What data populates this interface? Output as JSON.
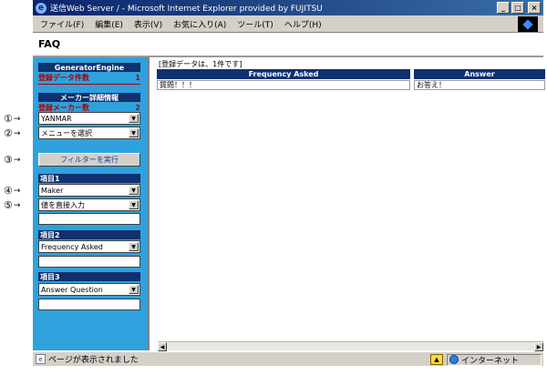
{
  "window": {
    "title": "送信Web Server / - Microsoft Internet Explorer provided by FUJITSU",
    "buttons": [
      "_",
      "□",
      "×"
    ]
  },
  "menu": [
    "ファイル(F)",
    "編集(E)",
    "表示(V)",
    "お気に入り(A)",
    "ツール(T)",
    "ヘルプ(H)"
  ],
  "page": {
    "title": "FAQ"
  },
  "sidebar": {
    "engine_header": "GeneratorEngine",
    "registered_data": {
      "label": "登録データ件数",
      "value": "1"
    },
    "maker_header": "メーカー詳細情報",
    "registered_makers": {
      "label": "登録メーカー数",
      "value": "2"
    },
    "maker_select": "YANMAR",
    "menu_select": "メニューを選択",
    "filter_button": "フィルターを実行",
    "item1": {
      "header": "項目1",
      "field": "Maker",
      "mode": "値を直接入力"
    },
    "item2": {
      "header": "項目2",
      "field": "Frequency Asked"
    },
    "item3": {
      "header": "項目3",
      "field": "Answer Question"
    }
  },
  "callouts": [
    "①",
    "②",
    "③",
    "④",
    "⑤"
  ],
  "main": {
    "count_text": "[登録データは、1件です]",
    "columns": [
      "Frequency Asked",
      "Answer"
    ],
    "rows": [
      [
        "質問！！！",
        "お答え！"
      ]
    ]
  },
  "status": {
    "text": "ページが表示されました",
    "zone": "インターネット"
  }
}
